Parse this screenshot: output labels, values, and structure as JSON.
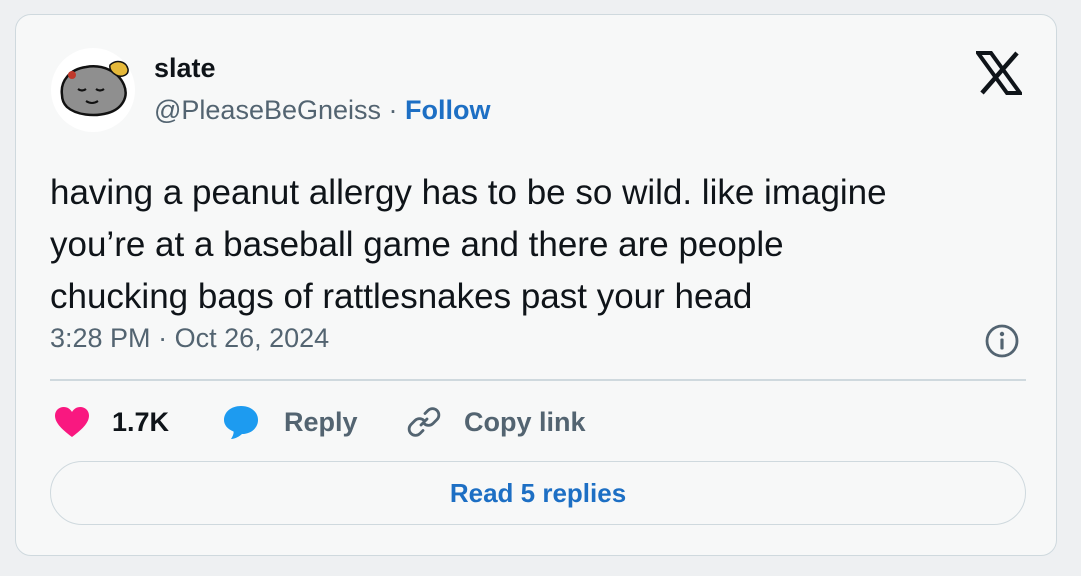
{
  "author": {
    "name": "slate",
    "handle": "@PleaseBeGneiss",
    "separator": " · ",
    "follow_label": "Follow"
  },
  "tweet": {
    "text_lines": [
      "having a peanut allergy has to be so wild. like imagine",
      "you’re at a baseball game and there are people",
      "chucking bags of rattlesnakes past your head"
    ],
    "time": "3:28 PM",
    "separator": " · ",
    "date": "Oct 26, 2024"
  },
  "actions": {
    "likes_count": "1.7K",
    "reply_label": "Reply",
    "copy_link_label": "Copy link"
  },
  "read_replies_label": "Read 5 replies",
  "icons": {
    "brand": "x-logo-icon",
    "info": "info-icon",
    "like": "heart-icon",
    "reply": "speech-bubble-icon",
    "copy": "link-icon"
  },
  "colors": {
    "text": "#0f1419",
    "secondary_text": "#536471",
    "link": "#1d6fc4",
    "like": "#f91880",
    "reply": "#1d9bf0",
    "border": "#cfd9de",
    "card_background": "#f7f8f8"
  }
}
